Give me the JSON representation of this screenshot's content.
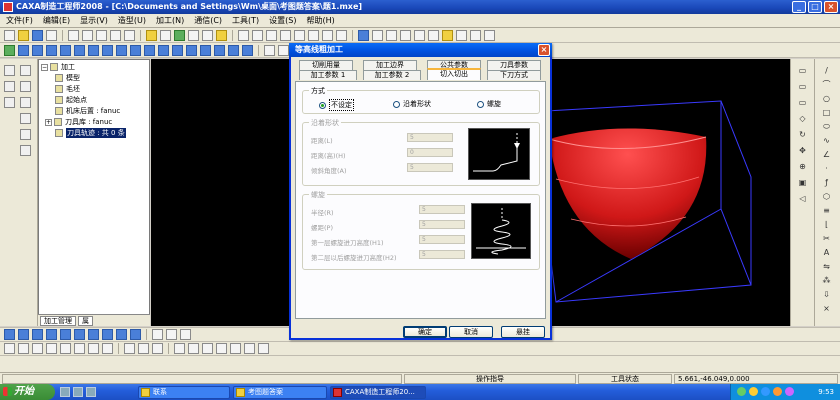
{
  "app": {
    "title": "CAXA制造工程师2008  - [C:\\Documents and Settings\\Wm\\桌面\\考图题答案\\题1.mxe]"
  },
  "menu": [
    "文件(F)",
    "编辑(E)",
    "显示(V)",
    "造型(U)",
    "加工(N)",
    "通信(C)",
    "工具(T)",
    "设置(S)",
    "帮助(H)"
  ],
  "tree": {
    "root": "加工",
    "items": [
      "模型",
      "毛坯",
      "起始点",
      "机床后置 : fanuc",
      "刀具库 : fanuc",
      "刀具轨迹 : 共 0 条"
    ],
    "tabs": [
      "加工管理",
      "属"
    ]
  },
  "dialog": {
    "title": "等高线粗加工",
    "close": "×",
    "tabs_row1": [
      "切削用量",
      "加工边界",
      "公共参数",
      "刀具参数"
    ],
    "tabs_row2": [
      "加工参数 1",
      "加工参数 2",
      "切入切出",
      "下刀方式"
    ],
    "active_tab": "切入切出",
    "mode_group": {
      "title": "方式",
      "options": [
        "不设定",
        "沿着形状",
        "螺旋"
      ],
      "selected": "不设定"
    },
    "shape_group": {
      "title": "沿着形状",
      "fields": [
        {
          "label": "距离(L)",
          "value": "5"
        },
        {
          "label": "距离(高)(H)",
          "value": "0"
        },
        {
          "label": "倾斜角度(A)",
          "value": "5"
        }
      ]
    },
    "helix_group": {
      "title": "螺旋",
      "fields": [
        {
          "label": "半径(R)",
          "value": "5"
        },
        {
          "label": "螺距(P)",
          "value": "5"
        },
        {
          "label": "第一层螺旋进刀高度(H1)",
          "value": "5"
        },
        {
          "label": "第二层以后螺旋进刀高度(H2)",
          "value": "5"
        }
      ]
    },
    "buttons": {
      "ok": "确定",
      "cancel": "取消",
      "hide": "悬挂"
    }
  },
  "status": {
    "prompt": "操作指导",
    "tool_state": "工具状态",
    "coords": "5.661,-46.049,0.000"
  },
  "taskbar": {
    "start": "开始",
    "items": [
      "联系",
      "考图题答案",
      "CAXA制造工程师20..."
    ],
    "clock": "9:53"
  },
  "colors": {
    "accent": "#0054e3",
    "model": "#d01818",
    "bbox": "#3a3aff"
  }
}
